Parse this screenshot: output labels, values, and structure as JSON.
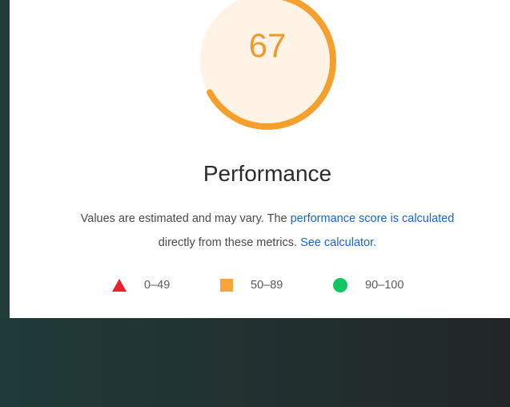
{
  "gauge": {
    "score": "67",
    "fraction": 0.67,
    "colors": {
      "arc": "#f5a02c",
      "fill": "#fff3e6",
      "text": "#f09a2a"
    }
  },
  "category": {
    "title": "Performance"
  },
  "description": {
    "text_before": "Values are estimated and may vary. The ",
    "link_score": "performance score is calculated",
    "text_middle": "directly from these metrics. ",
    "link_calculator": "See calculator."
  },
  "legend": [
    {
      "label": "0–49",
      "shape": "triangle",
      "color": "#e8222a"
    },
    {
      "label": "50–89",
      "shape": "square",
      "color": "#f7a43a"
    },
    {
      "label": "90–100",
      "shape": "circle",
      "color": "#12c462"
    }
  ]
}
